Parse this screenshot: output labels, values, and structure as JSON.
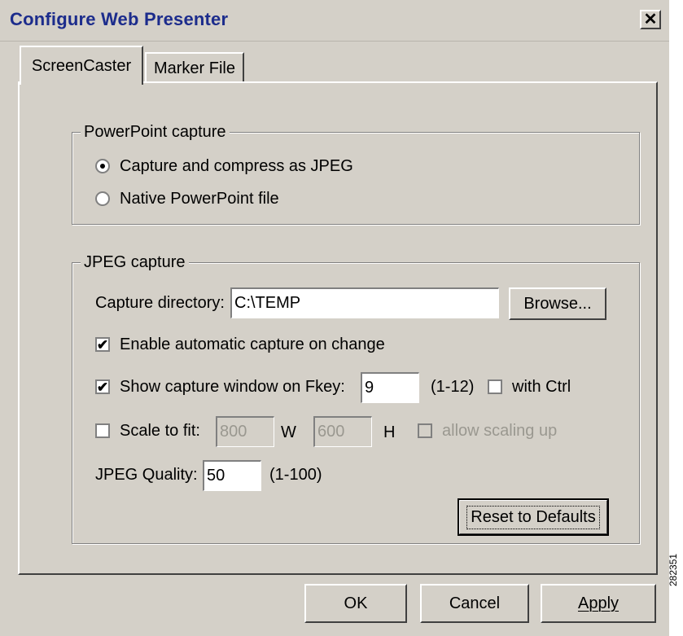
{
  "window": {
    "title": "Configure Web Presenter",
    "close_glyph": "✕"
  },
  "tabs": [
    {
      "label": "ScreenCaster",
      "active": true
    },
    {
      "label": "Marker File",
      "active": false
    }
  ],
  "powerpoint": {
    "title": "PowerPoint capture",
    "options": [
      {
        "label": "Capture and compress as JPEG",
        "selected": true
      },
      {
        "label": "Native PowerPoint file",
        "selected": false
      }
    ]
  },
  "jpeg": {
    "title": "JPEG capture",
    "directory_label": "Capture directory:",
    "directory_value": "C:\\TEMP",
    "browse_label": "Browse...",
    "auto_capture_label": "Enable automatic capture on change",
    "auto_capture_checked": true,
    "fkey_label": "Show capture window on Fkey:",
    "fkey_checked": true,
    "fkey_value": "9",
    "fkey_range": "(1-12)",
    "with_ctrl_label": "with Ctrl",
    "with_ctrl_checked": false,
    "scale_label": "Scale to fit:",
    "scale_checked": false,
    "width_value": "800",
    "width_unit": "W",
    "height_value": "600",
    "height_unit": "H",
    "scaling_up_label": "allow scaling up",
    "scaling_up_checked": false,
    "quality_label": "JPEG Quality:",
    "quality_value": "50",
    "quality_range": "(1-100)",
    "reset_label": "Reset to Defaults"
  },
  "buttons": {
    "ok": "OK",
    "cancel": "Cancel",
    "apply": "Apply"
  },
  "side_id": "282351",
  "colors": {
    "face": "#d4d0c8",
    "title_text": "#1c2c8c",
    "disabled_text": "#9a9890"
  },
  "icons": {
    "close": "close-icon",
    "check": "checkmark-icon",
    "radio": "radio-dot-icon"
  }
}
